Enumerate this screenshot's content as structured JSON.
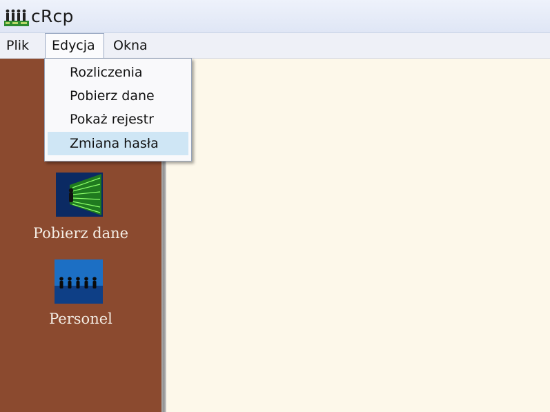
{
  "window": {
    "title": "cRcp",
    "icon": "people-app-icon"
  },
  "menubar": {
    "items": [
      {
        "label": "Plik",
        "state": "closed"
      },
      {
        "label": "Edycja",
        "state": "open"
      },
      {
        "label": "Okna",
        "state": "closed"
      }
    ]
  },
  "edit_menu": {
    "items": [
      {
        "label": "Rozliczenia"
      },
      {
        "label": "Pobierz dane"
      },
      {
        "label": "Pokaż rejestr"
      },
      {
        "label": "Zmiana hasła",
        "highlighted": true
      }
    ]
  },
  "sidebar": {
    "tiles": [
      {
        "label": "Pobierz dane",
        "icon": "data-download-icon"
      },
      {
        "label": "Personel",
        "icon": "personnel-icon"
      }
    ]
  },
  "colors": {
    "sidebar_bg": "#8b4a2f",
    "content_bg": "#fdf8ea",
    "menu_highlight": "#cfe6f5"
  }
}
